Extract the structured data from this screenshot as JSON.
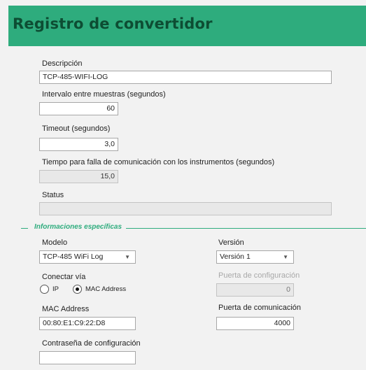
{
  "header": {
    "title": "Registro de convertidor"
  },
  "fields": {
    "descripcion": {
      "label": "Descripción",
      "value": "TCP-485-WIFI-LOG"
    },
    "intervalo": {
      "label": "Intervalo entre muestras (segundos)",
      "value": "60"
    },
    "timeout": {
      "label": "Timeout (segundos)",
      "value": "3,0"
    },
    "tiempo_falla": {
      "label": "Tiempo para falla de comunicación con los instrumentos (segundos)",
      "value": "15,0"
    },
    "status": {
      "label": "Status",
      "value": ""
    }
  },
  "section": {
    "title": "Informaciones específicas"
  },
  "modelo": {
    "label": "Modelo",
    "selected": "TCP-485 WiFi Log"
  },
  "version": {
    "label": "Versión",
    "selected": "Versión 1"
  },
  "conectar": {
    "label": "Conectar vía",
    "options": [
      {
        "label": "IP",
        "checked": false
      },
      {
        "label": "MAC Address",
        "checked": true
      }
    ]
  },
  "puerta_config": {
    "label": "Puerta de configuración",
    "value": "0"
  },
  "mac": {
    "label": "MAC Address",
    "value": "00:80:E1:C9:22:D8"
  },
  "puerta_com": {
    "label": "Puerta de comunicación",
    "value": "4000"
  },
  "contrasena": {
    "label": "Contraseña de configuración",
    "value": ""
  }
}
